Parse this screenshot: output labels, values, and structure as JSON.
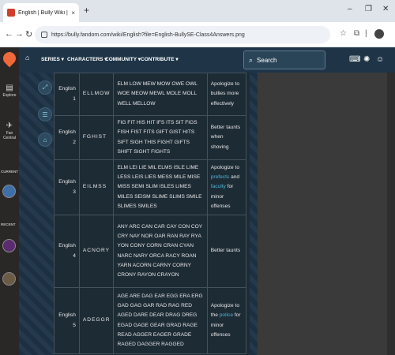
{
  "browser": {
    "tab_title": "English | Bully Wiki | Fandom",
    "tab_close": "×",
    "new_tab": "+",
    "url": "https://bully.fandom.com/wiki/English?file=English-BullySE-Class4Answers.png",
    "min": "–",
    "max": "❐",
    "close": "✕"
  },
  "global_nav": {
    "explore_label": "Explore",
    "fan_central_label": "Fan Central",
    "current_label": "CURRENT",
    "recent_label": "RECENT"
  },
  "wiki_header": {
    "nav": [
      "SERIES ▾",
      "CHARACTERS ▾",
      "COMMUNITY ▾",
      "CONTRIBUTE ▾"
    ],
    "search_label": "Search"
  },
  "answers": [
    {
      "class": "English 1",
      "letters": "ELLMOW",
      "words": "ELM LOW MEW MOW OWE OWL WOE MEOW MEWL MOLE MOLL WELL MELLOW",
      "effect": [
        "Apologize to bullies more effectively"
      ]
    },
    {
      "class": "English 2",
      "letters": "FGHIST",
      "words": "FIG FIT HIS HIT IFS ITS SIT FIGS FISH FIST FITS GIFT GIST HITS SIFT SIGH THIS FIGHT GIFTS SHIFT SIGHT FIGHTS",
      "effect": [
        "Better taunts when shoving"
      ]
    },
    {
      "class": "English 3",
      "letters": "EILMSS",
      "words": "ELM LEI LIE MIL ELMS ISLE LIME LESS LEIS LIES MESS MILE MISE MISS SEMI SLIM ISLES LIMES MILES SEISM SLIME SLIMS SMILE SLIMES SMILES",
      "effect": [
        "Apologize to ",
        "prefects",
        " and ",
        "faculty",
        " for minor offenses"
      ]
    },
    {
      "class": "English 4",
      "letters": "ACNORY",
      "words": "ANY ARC CAN CAR CAY CON COY CRY NAY NOR OAR RAN RAY RYA YON CONY CORN CRAN CYAN NARC NARY ORCA RACY ROAN YARN ACORN CARNY CORNY CRONY RAYON CRAYON",
      "effect": [
        "Better taunts"
      ]
    },
    {
      "class": "English 5",
      "letters": "ADEGGR",
      "words": "AGE ARE DAG EAR EGG ERA ERG GAD GAG GAR RAD RAG RED AGED DARE DEAR DRAG DREG EGAD GAGE GEAR GRAD RAGE READ AGGER EAGER GRADE RAGED DAGGER RAGGED",
      "effect": [
        "Apologize to the ",
        "police",
        " for minor offenses"
      ]
    }
  ]
}
